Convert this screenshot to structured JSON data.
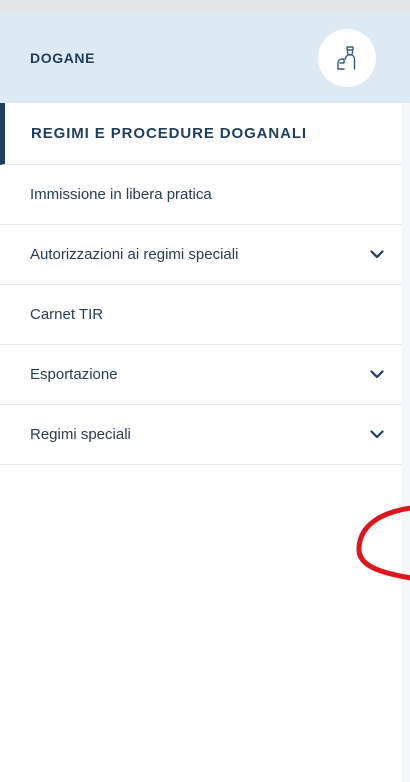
{
  "header": {
    "title": "DOGANE",
    "icon": "customs-officer-icon"
  },
  "section": {
    "title": "REGIMI E PROCEDURE DOGANALI"
  },
  "menu": {
    "items": [
      {
        "label": "Immissione in libera pratica",
        "has_submenu": false
      },
      {
        "label": "Autorizzazioni ai regimi speciali",
        "has_submenu": true
      },
      {
        "label": "Carnet TIR",
        "has_submenu": false
      },
      {
        "label": "Esportazione",
        "has_submenu": true
      },
      {
        "label": "Regimi speciali",
        "has_submenu": true
      }
    ]
  },
  "colors": {
    "header_bg": "#dde9f3",
    "primary_text": "#1f3d5c",
    "annotation": "#e0141c"
  }
}
